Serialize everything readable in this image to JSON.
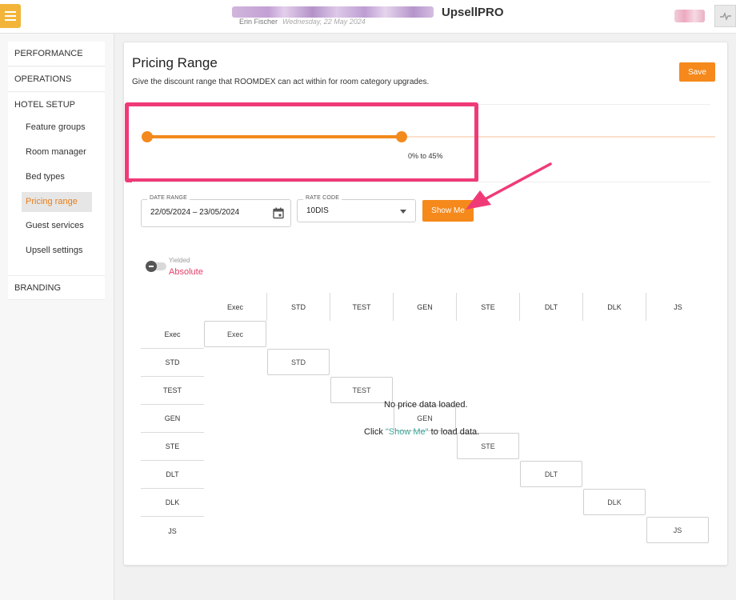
{
  "header": {
    "app_name": "UpsellPRO",
    "user_name": "Erin Fischer",
    "date": "Wednesday, 22 May 2024"
  },
  "sidebar": {
    "performance": "PERFORMANCE",
    "operations": "OPERATIONS",
    "hotel_setup": "HOTEL SETUP",
    "items": [
      {
        "label": "Feature groups"
      },
      {
        "label": "Room manager"
      },
      {
        "label": "Bed types"
      },
      {
        "label": "Pricing range",
        "active": true
      },
      {
        "label": "Guest services"
      },
      {
        "label": "Upsell settings"
      }
    ],
    "branding": "BRANDING"
  },
  "main": {
    "title": "Pricing Range",
    "subtitle": "Give the discount range that ROOMDEX can act within for room category upgrades.",
    "save_label": "Save",
    "slider": {
      "min_percent": 0,
      "max_percent": 45,
      "label": "0% to 45%"
    },
    "date_range": {
      "label": "DATE RANGE",
      "value": "22/05/2024 – 23/05/2024"
    },
    "rate_code": {
      "label": "RATE CODE",
      "value": "10DIS"
    },
    "show_me_label": "Show Me",
    "toggle": {
      "yielded": "Yielded",
      "absolute": "Absolute"
    },
    "grid": {
      "categories": [
        "Exec",
        "STD",
        "TEST",
        "GEN",
        "STE",
        "DLT",
        "DLK",
        "JS"
      ]
    },
    "empty_message": {
      "line1": "No price data loaded.",
      "click": "Click",
      "quoted": "\"Show Me\"",
      "rest": "to load data."
    }
  },
  "colors": {
    "accent": "#f5891b",
    "highlight": "#f03a78",
    "absolute": "#e23e68",
    "link": "#3aa79a"
  }
}
